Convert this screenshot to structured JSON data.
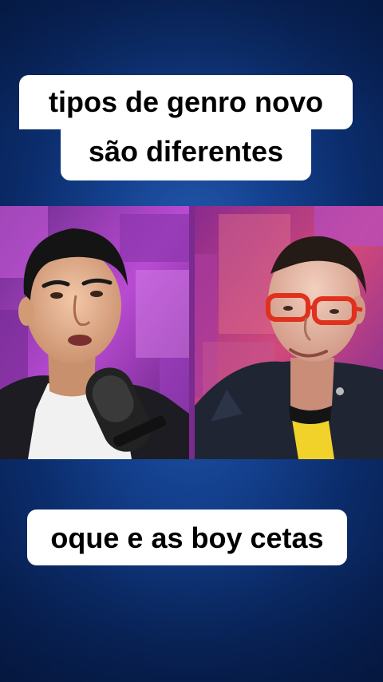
{
  "captions": {
    "top_line_1": "tipos de genro novo",
    "top_line_2": "são diferentes",
    "bottom": "oque e as boy cetas"
  },
  "colors": {
    "background": "#14418f",
    "caption_bg": "#ffffff",
    "caption_text": "#000000",
    "set_purple": "#b23bd0",
    "glasses_red": "#e0301e"
  },
  "scene": {
    "left_panel": "speaker with microphone",
    "right_panel": "guest with red glasses"
  }
}
